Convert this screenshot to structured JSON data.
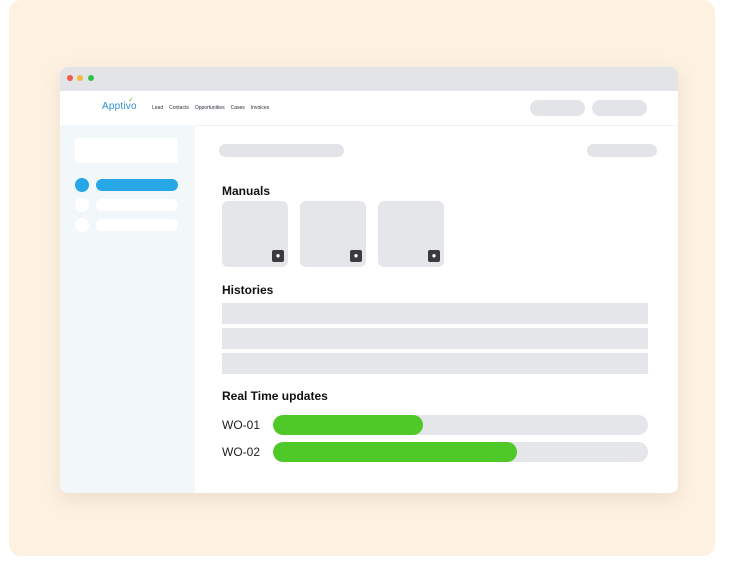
{
  "brand": {
    "logo_text": "Apptivo",
    "logo_leaf": "✓"
  },
  "nav": {
    "links": [
      "Lead",
      "Contacts",
      "Opportunities",
      "Cases",
      "Invoices"
    ]
  },
  "sections": {
    "manuals": "Manuals",
    "histories": "Histories",
    "realtime": "Real Time updates"
  },
  "manuals": {
    "items": [
      {
        "icon": "document-download-icon"
      },
      {
        "icon": "document-download-icon"
      },
      {
        "icon": "document-download-icon"
      }
    ]
  },
  "updates": [
    {
      "label": "WO-01",
      "progress": 0.4
    },
    {
      "label": "WO-02",
      "progress": 0.65
    }
  ],
  "colors": {
    "accent": "#28a7e6",
    "progress": "#4fc928",
    "background": "#fdf1e2",
    "sidebar": "#f2f7fa"
  }
}
